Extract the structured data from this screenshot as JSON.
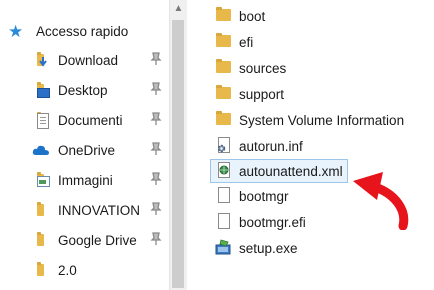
{
  "navigation": {
    "quick_access_label": "Accesso rapido",
    "items": [
      {
        "label": "Download",
        "icon": "download-folder-icon",
        "pinned": true
      },
      {
        "label": "Desktop",
        "icon": "desktop-icon",
        "pinned": true
      },
      {
        "label": "Documenti",
        "icon": "documents-icon",
        "pinned": true
      },
      {
        "label": "OneDrive",
        "icon": "onedrive-cloud-icon",
        "pinned": true
      },
      {
        "label": "Immagini",
        "icon": "pictures-icon",
        "pinned": true
      },
      {
        "label": "INNOVATION",
        "icon": "folder-icon",
        "pinned": true
      },
      {
        "label": "Google Drive",
        "icon": "folder-icon",
        "pinned": true
      },
      {
        "label": "2.0",
        "icon": "folder-icon",
        "pinned": false
      }
    ]
  },
  "files": [
    {
      "name": "boot",
      "type": "folder"
    },
    {
      "name": "efi",
      "type": "folder"
    },
    {
      "name": "sources",
      "type": "folder"
    },
    {
      "name": "support",
      "type": "folder"
    },
    {
      "name": "System Volume Information",
      "type": "folder"
    },
    {
      "name": "autorun.inf",
      "type": "settings-file"
    },
    {
      "name": "autounattend.xml",
      "type": "xml-file",
      "selected": true
    },
    {
      "name": "bootmgr",
      "type": "file"
    },
    {
      "name": "bootmgr.efi",
      "type": "file"
    },
    {
      "name": "setup.exe",
      "type": "installer"
    }
  ],
  "annotation": {
    "icon": "red-curved-arrow-icon",
    "color": "#e8141b"
  },
  "colors": {
    "folder": "#e8b94a",
    "accent": "#2b8bd9",
    "selection": "#e9f3fc"
  }
}
